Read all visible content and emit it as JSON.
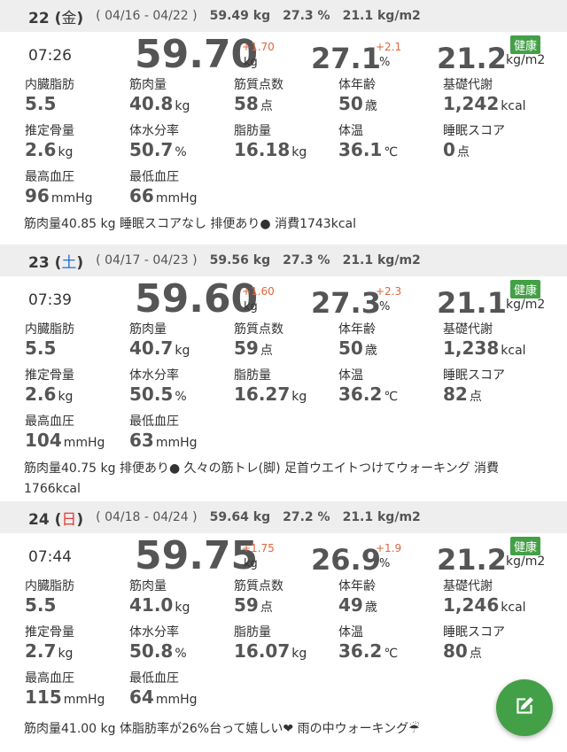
{
  "days": [
    {
      "header": {
        "date_num": "22",
        "weekday": "金",
        "range": "( 04/16 - 04/22 )",
        "weight": "59.49 kg",
        "fat": "27.3 %",
        "bmi": "21.1 kg/m2"
      },
      "time": "07:26",
      "weight": {
        "value": "59.70",
        "delta": "+1.70",
        "unit": "kg"
      },
      "fat": {
        "value": "27.1",
        "delta": "+2.1",
        "unit": "%"
      },
      "bmi": {
        "value": "21.2",
        "unit": "kg/m2",
        "badge": "健康"
      },
      "metrics": [
        {
          "label": "内臓脂肪",
          "value": "5.5",
          "unit": ""
        },
        {
          "label": "筋肉量",
          "value": "40.8",
          "unit": "kg"
        },
        {
          "label": "筋質点数",
          "value": "58",
          "unit": "点"
        },
        {
          "label": "体年齢",
          "value": "50",
          "unit": "歳"
        },
        {
          "label": "基礎代謝",
          "value": "1,242",
          "unit": "kcal"
        },
        {
          "label": "推定骨量",
          "value": "2.6",
          "unit": "kg"
        },
        {
          "label": "体水分率",
          "value": "50.7",
          "unit": "%"
        },
        {
          "label": "脂肪量",
          "value": "16.18",
          "unit": "kg"
        },
        {
          "label": "体温",
          "value": "36.1",
          "unit": "℃"
        },
        {
          "label": "睡眠スコア",
          "value": "0",
          "unit": "点"
        },
        {
          "label": "最高血圧",
          "value": "96",
          "unit": "mmHg"
        },
        {
          "label": "最低血圧",
          "value": "66",
          "unit": "mmHg"
        }
      ],
      "memo": "筋肉量40.85 kg 睡眠スコアなし 排便あり● 消費1743kcal"
    },
    {
      "header": {
        "date_num": "23",
        "weekday": "土",
        "range": "( 04/17 - 04/23 )",
        "weight": "59.56 kg",
        "fat": "27.3 %",
        "bmi": "21.1 kg/m2"
      },
      "time": "07:39",
      "weight": {
        "value": "59.60",
        "delta": "+1.60",
        "unit": "kg"
      },
      "fat": {
        "value": "27.3",
        "delta": "+2.3",
        "unit": "%"
      },
      "bmi": {
        "value": "21.1",
        "unit": "kg/m2",
        "badge": "健康"
      },
      "metrics": [
        {
          "label": "内臓脂肪",
          "value": "5.5",
          "unit": ""
        },
        {
          "label": "筋肉量",
          "value": "40.7",
          "unit": "kg"
        },
        {
          "label": "筋質点数",
          "value": "59",
          "unit": "点"
        },
        {
          "label": "体年齢",
          "value": "50",
          "unit": "歳"
        },
        {
          "label": "基礎代謝",
          "value": "1,238",
          "unit": "kcal"
        },
        {
          "label": "推定骨量",
          "value": "2.6",
          "unit": "kg"
        },
        {
          "label": "体水分率",
          "value": "50.5",
          "unit": "%"
        },
        {
          "label": "脂肪量",
          "value": "16.27",
          "unit": "kg"
        },
        {
          "label": "体温",
          "value": "36.2",
          "unit": "℃"
        },
        {
          "label": "睡眠スコア",
          "value": "82",
          "unit": "点"
        },
        {
          "label": "最高血圧",
          "value": "104",
          "unit": "mmHg"
        },
        {
          "label": "最低血圧",
          "value": "63",
          "unit": "mmHg"
        }
      ],
      "memo": "筋肉量40.75 kg 排便あり● 久々の筋トレ(脚) 足首ウエイトつけてウォーキング 消費1766kcal"
    },
    {
      "header": {
        "date_num": "24",
        "weekday": "日",
        "range": "( 04/18 - 04/24 )",
        "weight": "59.64 kg",
        "fat": "27.2 %",
        "bmi": "21.1 kg/m2"
      },
      "time": "07:44",
      "weight": {
        "value": "59.75",
        "delta": "+1.75",
        "unit": "kg"
      },
      "fat": {
        "value": "26.9",
        "delta": "+1.9",
        "unit": "%"
      },
      "bmi": {
        "value": "21.2",
        "unit": "kg/m2",
        "badge": "健康"
      },
      "metrics": [
        {
          "label": "内臓脂肪",
          "value": "5.5",
          "unit": ""
        },
        {
          "label": "筋肉量",
          "value": "41.0",
          "unit": "kg"
        },
        {
          "label": "筋質点数",
          "value": "59",
          "unit": "点"
        },
        {
          "label": "体年齢",
          "value": "49",
          "unit": "歳"
        },
        {
          "label": "基礎代謝",
          "value": "1,246",
          "unit": "kcal"
        },
        {
          "label": "推定骨量",
          "value": "2.7",
          "unit": "kg"
        },
        {
          "label": "体水分率",
          "value": "50.8",
          "unit": "%"
        },
        {
          "label": "脂肪量",
          "value": "16.07",
          "unit": "kg"
        },
        {
          "label": "体温",
          "value": "36.2",
          "unit": "℃"
        },
        {
          "label": "睡眠スコア",
          "value": "80",
          "unit": "点"
        },
        {
          "label": "最高血圧",
          "value": "115",
          "unit": "mmHg"
        },
        {
          "label": "最低血圧",
          "value": "64",
          "unit": "mmHg"
        }
      ],
      "memo": "筋肉量41.00 kg 体脂肪率が26%台って嬉しい❤ 雨の中ウォーキング☔"
    }
  ],
  "fab": {
    "icon": "edit-icon",
    "color": "#43a047"
  },
  "colors": {
    "saturday": "#1e6fd6",
    "sunday": "#e53935",
    "delta": "#e0663b",
    "badge": "#43a047"
  }
}
